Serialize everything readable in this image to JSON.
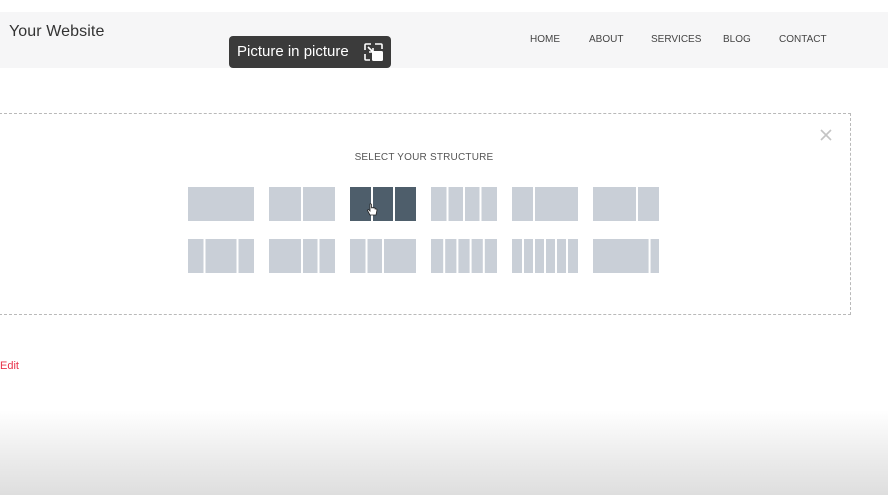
{
  "header": {
    "site_title": "Your Website",
    "nav": [
      "HOME",
      "ABOUT",
      "SERVICES",
      "BLOG",
      "CONTACT"
    ]
  },
  "pip": {
    "label": "Picture in picture",
    "icon": "picture-in-picture-icon"
  },
  "structure_dialog": {
    "title": "SELECT YOUR STRUCTURE",
    "close_icon": "close-icon",
    "selected_index": 2,
    "layouts": [
      {
        "columns": [
          1
        ]
      },
      {
        "columns": [
          1,
          1
        ]
      },
      {
        "columns": [
          1,
          1,
          1
        ]
      },
      {
        "columns": [
          1,
          1,
          1,
          1
        ]
      },
      {
        "columns": [
          1,
          2
        ]
      },
      {
        "columns": [
          2,
          1
        ]
      },
      {
        "columns": [
          1,
          2,
          1
        ]
      },
      {
        "columns": [
          2,
          1,
          1
        ]
      },
      {
        "columns": [
          1,
          1,
          2
        ]
      },
      {
        "columns": [
          1,
          1,
          1,
          1,
          1
        ]
      },
      {
        "columns": [
          1,
          1,
          1,
          1,
          1,
          1
        ]
      },
      {
        "columns": [
          6,
          1
        ]
      }
    ]
  },
  "edit_link": "Edit",
  "colors": {
    "tile": "#c9cfd7",
    "tile_selected": "#4e5e6b",
    "divider": "#ffffff",
    "accent": "#e8334a"
  }
}
